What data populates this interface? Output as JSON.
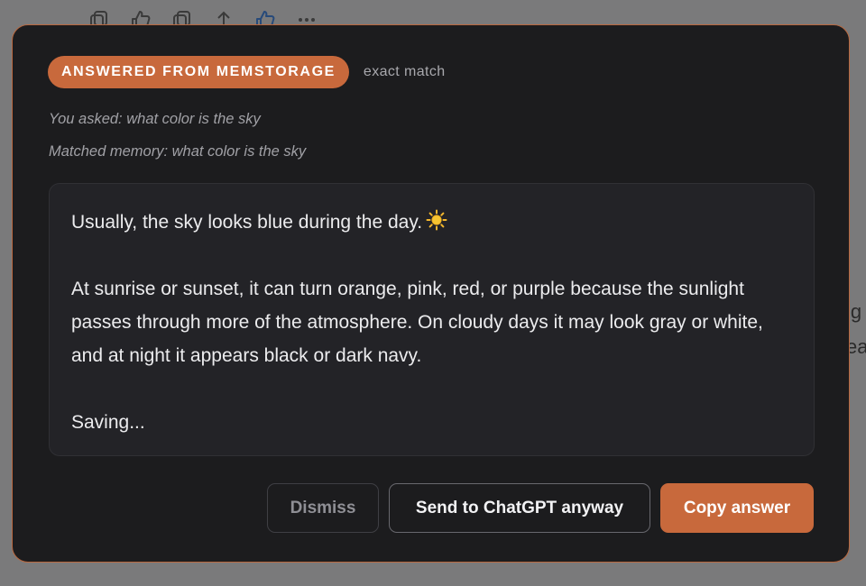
{
  "background": {
    "toolbar_icons": [
      "copy-icon",
      "thumbs-up-icon",
      "copy-icon",
      "share-icon",
      "thumbs-up-icon",
      "more-icon"
    ],
    "side_text_1": "ig",
    "side_text_2": "ea"
  },
  "modal": {
    "badge": "ANSWERED FROM MEMSTORAGE",
    "match_type": "exact match",
    "you_asked": "You asked: what color is the sky",
    "matched_memory": "Matched memory: what color is the sky",
    "answer": {
      "line1": "Usually, the sky looks blue during the day.",
      "line1_icon": "sun-emoji-icon",
      "paragraph2": "At sunrise or sunset, it can turn orange, pink, red, or purple because the sunlight passes through more of the atmosphere. On cloudy days it may look gray or white, and at night it appears black or dark navy.",
      "status": "Saving..."
    },
    "buttons": {
      "dismiss": "Dismiss",
      "send": "Send to ChatGPT anyway",
      "copy": "Copy answer"
    }
  },
  "colors": {
    "accent": "#c8693c",
    "modal_bg": "#1c1c1e",
    "answer_bg": "#232327"
  }
}
